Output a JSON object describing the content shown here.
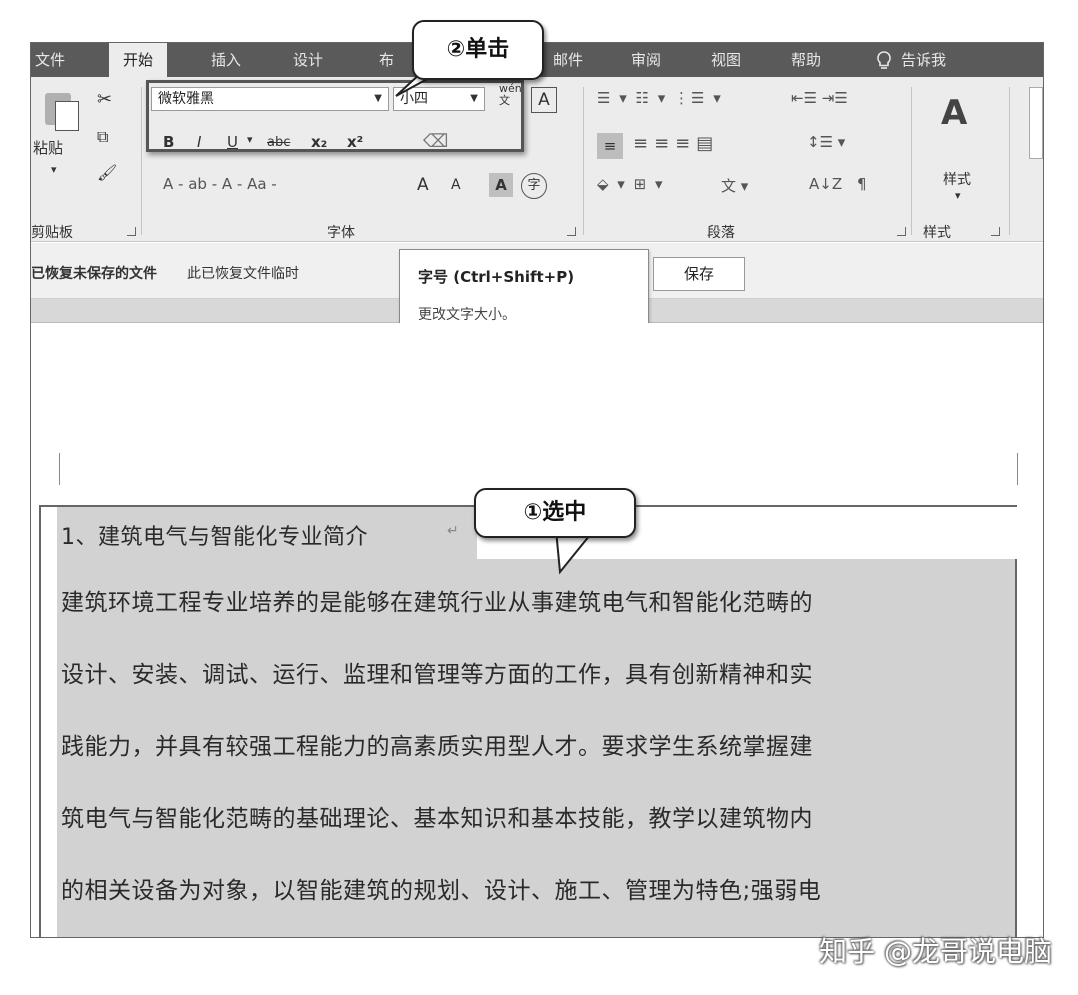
{
  "tabs": {
    "file": "文件",
    "home": "开始",
    "insert": "插入",
    "design": "设计",
    "layout": "布",
    "mailings": "邮件",
    "review": "审阅",
    "view": "视图",
    "help": "帮助",
    "tellme": "告诉我"
  },
  "ribbon": {
    "clipboard": {
      "paste": "粘贴",
      "label": "剪贴板"
    },
    "font": {
      "name": "微软雅黑",
      "size": "小四",
      "bold": "B",
      "italic": "I",
      "underline": "U",
      "strike": "abc",
      "subscript": "x₂",
      "superscript": "x²",
      "row3": "A - ab - A - Aa -",
      "grow": "A",
      "shrink": "A",
      "label": "字体"
    },
    "paragraph": {
      "label": "段落"
    },
    "styles": {
      "button": "样式",
      "label": "样式"
    }
  },
  "infobar": {
    "title": "已恢复未保存的文件",
    "message": "此已恢复文件临时",
    "save": "保存"
  },
  "tooltip": {
    "title": "字号 (Ctrl+Shift+P)",
    "description": "更改文字大小。"
  },
  "callouts": {
    "click": "②单击",
    "select": "①选中"
  },
  "document": {
    "heading": "1、建筑电气与智能化专业简介",
    "lines": [
      "建筑环境工程专业培养的是能够在建筑行业从事建筑电气和智能化范畴的",
      "设计、安装、调试、运行、监理和管理等方面的工作，具有创新精神和实",
      "践能力，并具有较强工程能力的高素质实用型人才。要求学生系统掌握建",
      "筑电气与智能化范畴的基础理论、基本知识和基本技能，教学以建筑物内",
      "的相关设备为对象，以智能建筑的规划、设计、施工、管理为特色;强弱电"
    ]
  },
  "watermark": "知乎 @龙哥说电脑"
}
